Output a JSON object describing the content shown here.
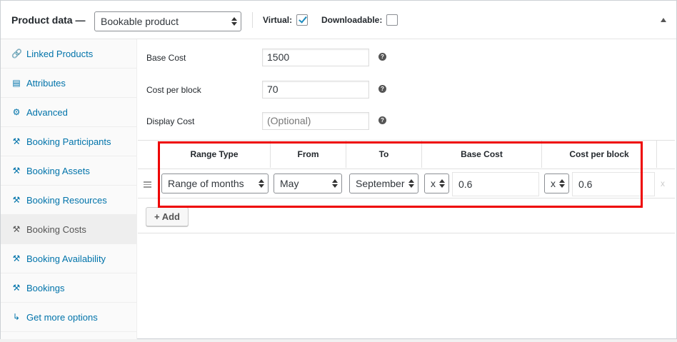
{
  "header": {
    "title": "Product data —",
    "product_type": "Bookable product",
    "virtual_label": "Virtual:",
    "virtual_checked": true,
    "downloadable_label": "Downloadable:",
    "downloadable_checked": false
  },
  "sidebar": {
    "items": [
      {
        "label": "Linked Products",
        "icon": "link-icon",
        "glyph": "🔗"
      },
      {
        "label": "Attributes",
        "icon": "list-icon",
        "glyph": "▤"
      },
      {
        "label": "Advanced",
        "icon": "gear-icon",
        "glyph": "⚙"
      },
      {
        "label": "Booking Participants",
        "icon": "wrench-icon",
        "glyph": "⚒"
      },
      {
        "label": "Booking Assets",
        "icon": "wrench-icon",
        "glyph": "⚒"
      },
      {
        "label": "Booking Resources",
        "icon": "wrench-icon",
        "glyph": "⚒"
      },
      {
        "label": "Booking Costs",
        "icon": "wrench-icon",
        "glyph": "⚒",
        "active": true
      },
      {
        "label": "Booking Availability",
        "icon": "wrench-icon",
        "glyph": "⚒"
      },
      {
        "label": "Bookings",
        "icon": "wrench-icon",
        "glyph": "⚒"
      },
      {
        "label": "Get more options",
        "icon": "plug-icon",
        "glyph": "↳"
      }
    ]
  },
  "fields": {
    "base_cost": {
      "label": "Base Cost",
      "value": "1500",
      "help": "?"
    },
    "block_cost": {
      "label": "Cost per block",
      "value": "70",
      "help": "?"
    },
    "display_cost": {
      "label": "Display Cost",
      "placeholder": "(Optional)",
      "help": "?"
    }
  },
  "table": {
    "headers": {
      "range_type": "Range Type",
      "from": "From",
      "to": "To",
      "base_cost": "Base Cost",
      "block_cost": "Cost per block"
    },
    "row": {
      "range_type": "Range of months",
      "from": "May",
      "to": "September",
      "base_modifier": "x",
      "base_cost": "0.6",
      "block_modifier": "x",
      "block_cost": "0.6",
      "remove": "x"
    },
    "add_button": "+ Add"
  },
  "colors": {
    "highlight": "#e00000",
    "link": "#0073aa"
  }
}
